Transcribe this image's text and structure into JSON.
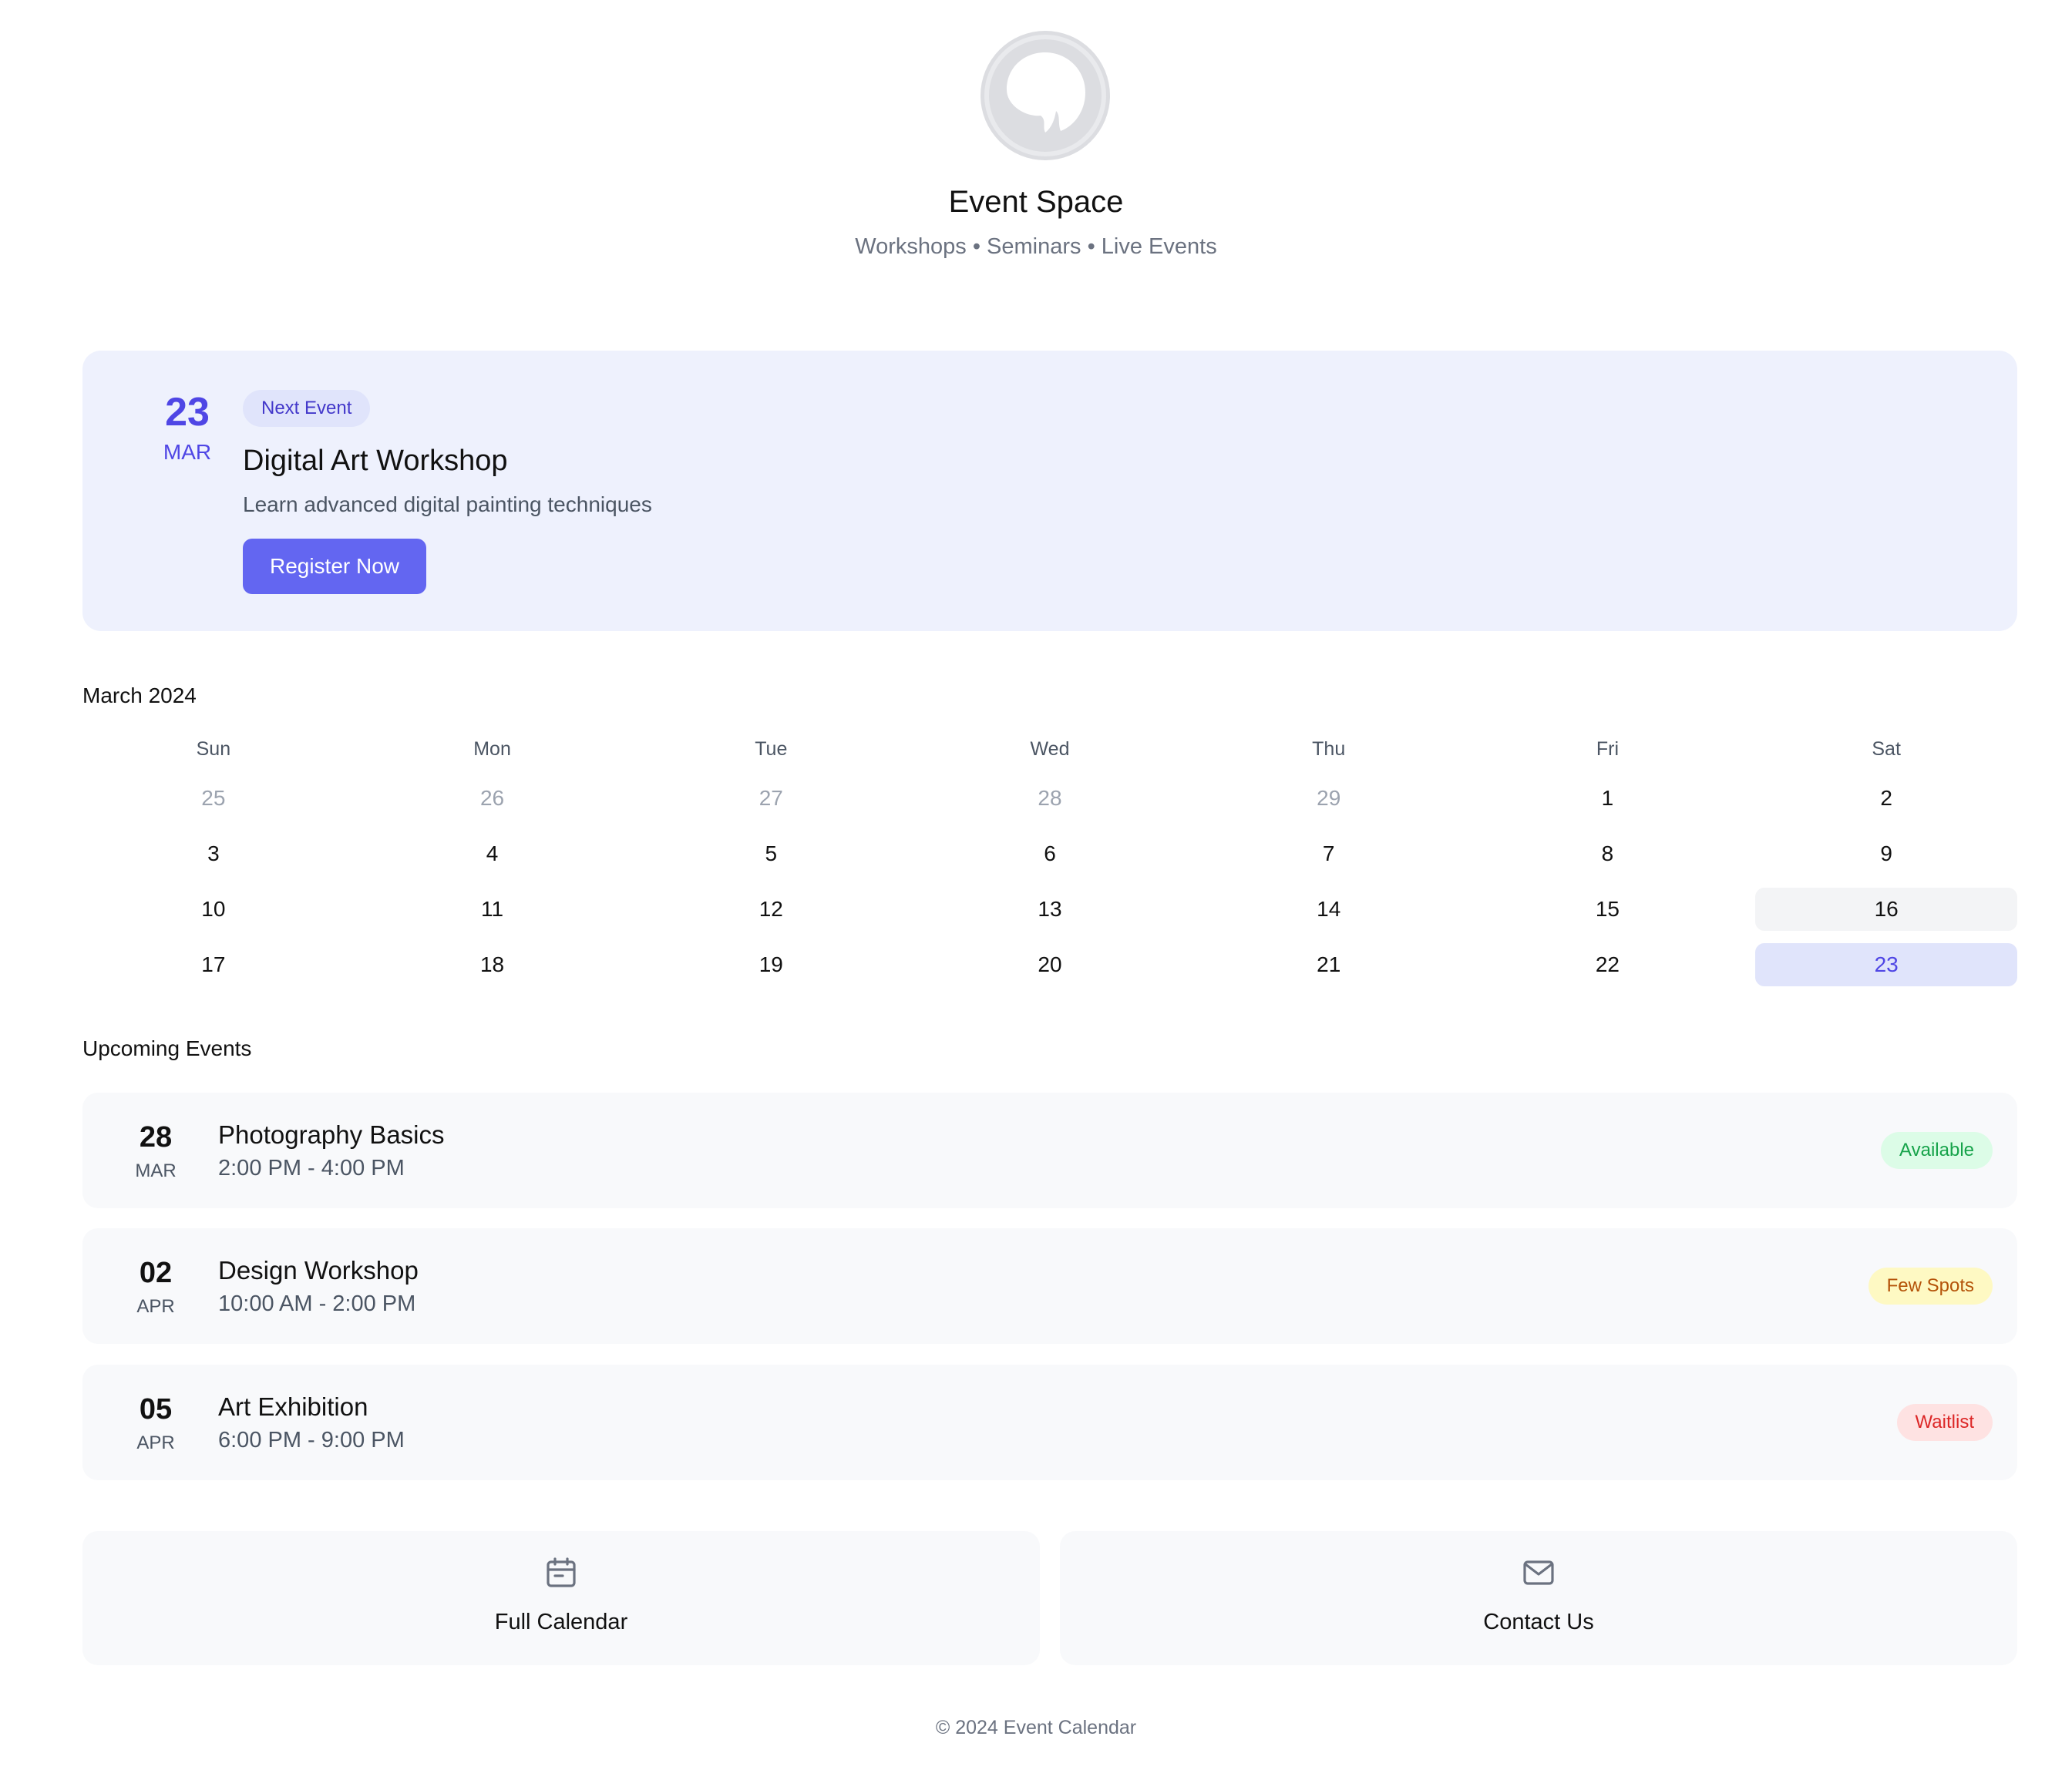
{
  "header": {
    "title": "Event Space",
    "tagline": "Workshops • Seminars • Live Events"
  },
  "featured": {
    "day": "23",
    "month": "MAR",
    "badge": "Next Event",
    "title": "Digital Art Workshop",
    "description": "Learn advanced digital painting techniques",
    "button_label": "Register Now"
  },
  "calendar": {
    "title": "March 2024",
    "weekdays": [
      "Sun",
      "Mon",
      "Tue",
      "Wed",
      "Thu",
      "Fri",
      "Sat"
    ],
    "cells": [
      {
        "day": "25",
        "state": "muted"
      },
      {
        "day": "26",
        "state": "muted"
      },
      {
        "day": "27",
        "state": "muted"
      },
      {
        "day": "28",
        "state": "muted"
      },
      {
        "day": "29",
        "state": "muted"
      },
      {
        "day": "1",
        "state": ""
      },
      {
        "day": "2",
        "state": ""
      },
      {
        "day": "3",
        "state": ""
      },
      {
        "day": "4",
        "state": ""
      },
      {
        "day": "5",
        "state": ""
      },
      {
        "day": "6",
        "state": ""
      },
      {
        "day": "7",
        "state": ""
      },
      {
        "day": "8",
        "state": ""
      },
      {
        "day": "9",
        "state": ""
      },
      {
        "day": "10",
        "state": ""
      },
      {
        "day": "11",
        "state": ""
      },
      {
        "day": "12",
        "state": ""
      },
      {
        "day": "13",
        "state": ""
      },
      {
        "day": "14",
        "state": ""
      },
      {
        "day": "15",
        "state": ""
      },
      {
        "day": "16",
        "state": "today"
      },
      {
        "day": "17",
        "state": ""
      },
      {
        "day": "18",
        "state": ""
      },
      {
        "day": "19",
        "state": ""
      },
      {
        "day": "20",
        "state": ""
      },
      {
        "day": "21",
        "state": ""
      },
      {
        "day": "22",
        "state": ""
      },
      {
        "day": "23",
        "state": "selected"
      }
    ]
  },
  "upcoming": {
    "title": "Upcoming Events",
    "events": [
      {
        "day": "28",
        "month": "MAR",
        "name": "Photography Basics",
        "time": "2:00 PM - 4:00 PM",
        "status": "Available",
        "status_color": "green"
      },
      {
        "day": "02",
        "month": "APR",
        "name": "Design Workshop",
        "time": "10:00 AM - 2:00 PM",
        "status": "Few Spots",
        "status_color": "yellow"
      },
      {
        "day": "05",
        "month": "APR",
        "name": "Art Exhibition",
        "time": "6:00 PM - 9:00 PM",
        "status": "Waitlist",
        "status_color": "red"
      }
    ]
  },
  "actions": {
    "calendar_label": "Full Calendar",
    "calendar_icon": "calendar-icon",
    "contact_label": "Contact Us",
    "contact_icon": "mail-icon"
  },
  "footer": {
    "text": "© 2024 Event Calendar"
  },
  "colors": {
    "accent": "#6366f1",
    "accent_text": "#4f46e5",
    "featured_bg": "#eef1fd",
    "card_bg": "#f8f9fb"
  }
}
